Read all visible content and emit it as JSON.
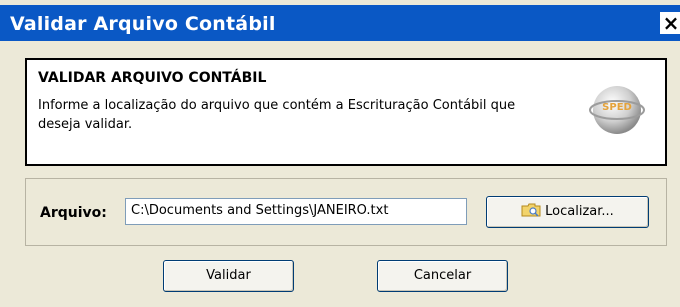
{
  "window": {
    "title": "Validar Arquivo Contábil",
    "close_label": "×"
  },
  "header": {
    "title": "VALIDAR ARQUIVO CONTÁBIL",
    "description": "Informe a localização do arquivo que contém a Escrituração Contábil que deseja validar.",
    "logo_text": "SPED"
  },
  "file": {
    "label": "Arquivo:",
    "value": "C:\\Documents and Settings\\JANEIRO.txt",
    "browse_label": "Localizar..."
  },
  "buttons": {
    "validate_label": "Validar",
    "cancel_label": "Cancelar"
  },
  "icons": {
    "browse": "folder-search-icon",
    "logo": "sped-logo-icon",
    "close": "close-icon"
  },
  "colors": {
    "titlebar": "#0a58c5",
    "window_bg": "#ece9d8"
  }
}
